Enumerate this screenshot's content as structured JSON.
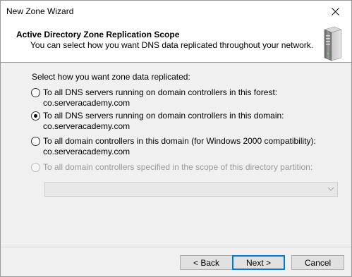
{
  "window": {
    "title": "New Zone Wizard",
    "close_glyph": "✕"
  },
  "header": {
    "title": "Active Directory Zone Replication Scope",
    "subtitle": "You can select how you want DNS data replicated throughout your network.",
    "icon": "server-icon"
  },
  "content": {
    "prompt": "Select how you want zone data replicated:",
    "options": [
      {
        "label": "To all DNS servers running on domain controllers in this forest: co.serveracademy.com",
        "checked": false,
        "enabled": true
      },
      {
        "label": "To all DNS servers running on domain controllers in this domain: co.serveracademy.com",
        "checked": true,
        "enabled": true
      },
      {
        "label_line1": "To all domain controllers in this domain (for Windows 2000 compatibility):",
        "label_line2": "co.serveracademy.com",
        "checked": false,
        "enabled": true
      },
      {
        "label": "To all domain controllers specified in the scope of this directory partition:",
        "checked": false,
        "enabled": false
      }
    ],
    "partition_select": {
      "value": "",
      "enabled": false
    }
  },
  "footer": {
    "back_label": "< Back",
    "next_label": "Next >",
    "cancel_label": "Cancel"
  }
}
